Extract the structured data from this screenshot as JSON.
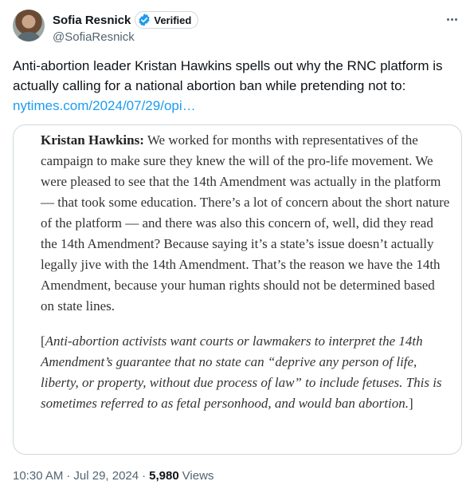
{
  "author": {
    "display_name": "Sofia Resnick",
    "handle": "@SofiaResnick",
    "verified_label": "Verified",
    "verified_color": "#1d9bf0"
  },
  "tweet": {
    "text": "Anti-abortion leader Kristan Hawkins spells out why the RNC platform is actually calling for a national abortion ban while pretending not to:",
    "link_text": "nytimes.com/2024/07/29/opi…"
  },
  "quote_image": {
    "speaker": "Kristan Hawkins:",
    "paragraph": " We worked for months with representatives of the campaign to make sure they knew the will of the pro-life movement. We were pleased to see that the 14th Amendment was actually in the platform — that took some education. There’s a lot of concern about the short nature of the platform — and there was also this concern of, well, did they read the 14th Amendment? Because saying it’s a state’s issue doesn’t actually legally jive with the 14th Amendment. That’s the reason we have the 14th Amendment, because your human rights should not be determined based on state lines.",
    "bracket_open": "[",
    "note": "Anti-abortion activists want courts or lawmakers to interpret the 14th Amendment’s guarantee that no state can “deprive any person of life, liberty, or property, without due process of law” to include fetuses. This is sometimes referred to as fetal personhood, and would ban abortion.",
    "bracket_close": "]"
  },
  "meta": {
    "time": "10:30 AM",
    "separator": "·",
    "date": "Jul 29, 2024",
    "views_count": "5,980",
    "views_label": "Views"
  },
  "icons": {
    "verified": "verified-badge-icon",
    "more": "more-horizontal-icon"
  }
}
